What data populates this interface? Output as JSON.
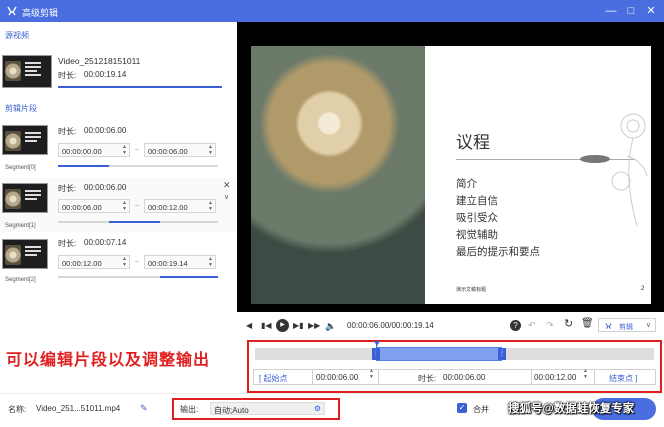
{
  "window": {
    "title": "高级剪辑"
  },
  "left": {
    "source_label": "源视频",
    "source": {
      "name": "Video_251218151011",
      "duration_label": "时长:",
      "duration": "00:00:19.14"
    },
    "segments_label": "剪辑片段",
    "segments": [
      {
        "caption": "Segment[0]",
        "duration_label": "时长:",
        "duration": "00:00:06.00",
        "start": "00:00:00.00",
        "end": "00:00:06.00"
      },
      {
        "caption": "Segment[1]",
        "duration_label": "时长:",
        "duration": "00:00:06.00",
        "start": "00:00:06.00",
        "end": "00:00:12.00"
      },
      {
        "caption": "Segment[2]",
        "duration_label": "时长:",
        "duration": "00:00:07.14",
        "start": "00:00:12.00",
        "end": "00:00:19.14"
      }
    ]
  },
  "slide": {
    "title": "议程",
    "items": [
      "简介",
      "建立自信",
      "吸引受众",
      "视觉辅助",
      "最后的提示和要点"
    ],
    "footer": "演示文稿标题",
    "page": "2"
  },
  "player": {
    "timecode": "00:00:06.00/00:00:19.14",
    "clip_label": "剪辑"
  },
  "trim": {
    "start_btn": "[ 起始点",
    "start_time": "00:00:06.00",
    "duration_label": "时长:",
    "duration": "00:00:06.00",
    "end_time": "00:00:12.00",
    "end_btn": "结束点 ]"
  },
  "annotation": "可以编辑片段以及调整输出",
  "bottom": {
    "name_label": "名称:",
    "name_value": "Video_251...51011.mp4",
    "output_label": "输出:",
    "output_value": "自动;Auto",
    "merge_label": "合并",
    "watermark": "搜狐号@数据蛙恢复专家"
  },
  "colors": {
    "accent": "#4a6ee0",
    "highlight": "#e02020"
  }
}
